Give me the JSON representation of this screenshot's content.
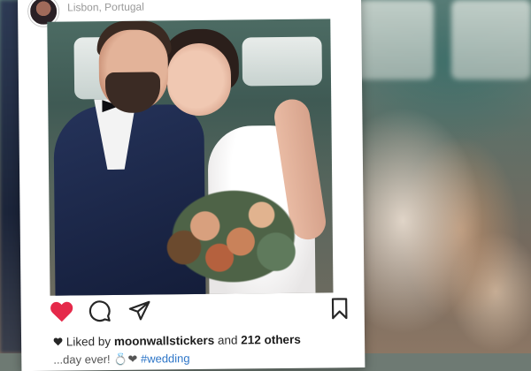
{
  "post": {
    "location": "Lisbon, Portugal",
    "liked_by_prefix": "Liked by",
    "liked_by_user": "moonwallstickers",
    "liked_by_conjunction": "and",
    "others": "212 others",
    "caption_text": "...day ever!",
    "hashtag": "#wedding"
  },
  "icons": {
    "like": "heart-icon",
    "comment": "comment-icon",
    "share": "send-icon",
    "save": "bookmark-icon",
    "small_like": "heart-icon"
  },
  "colors": {
    "heart": "#e5294a",
    "hashtag": "#2e76c8",
    "icon_stroke": "#262626"
  }
}
